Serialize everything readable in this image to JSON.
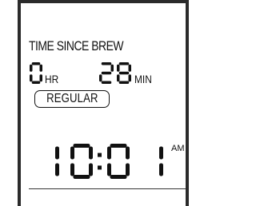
{
  "display": {
    "heading": "TIME SINCE BREW",
    "elapsed": {
      "hours": "0",
      "hours_unit": "HR",
      "minutes": "28",
      "minutes_unit": "MIN"
    },
    "brew_mode": "REGULAR",
    "clock": {
      "time": "10:01",
      "period": "AM"
    }
  },
  "colors": {
    "segment_on": "#111111",
    "background": "#ffffff",
    "frame": "#2b2b2b"
  }
}
